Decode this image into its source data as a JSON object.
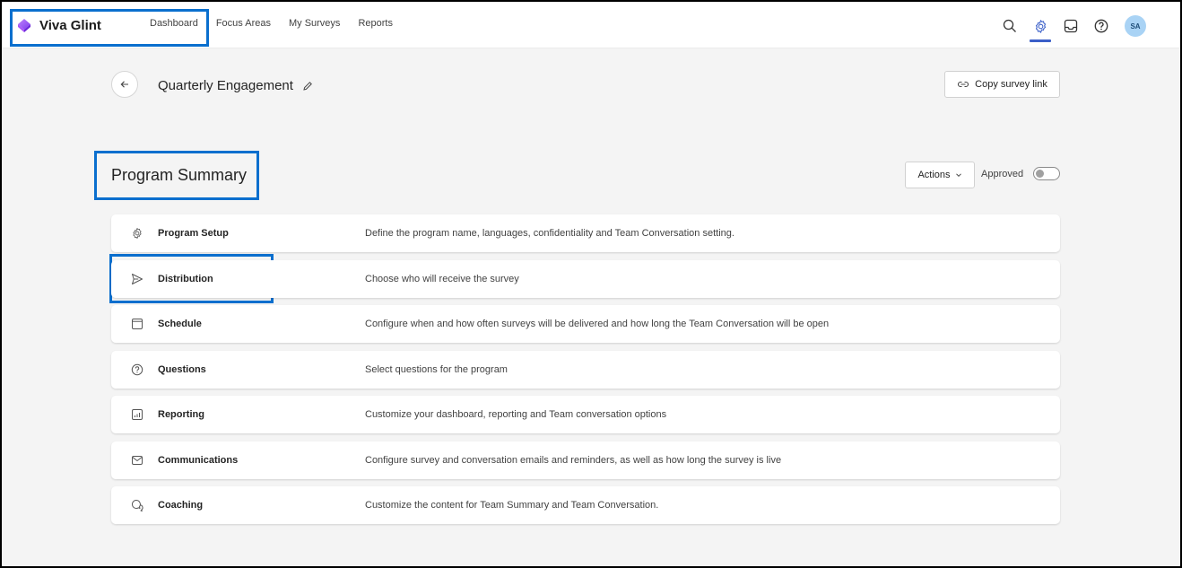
{
  "app": {
    "name": "Viva Glint"
  },
  "nav": {
    "items": [
      {
        "label": "Dashboard"
      },
      {
        "label": "Focus Areas"
      },
      {
        "label": "My Surveys"
      },
      {
        "label": "Reports"
      }
    ]
  },
  "header_icons": {
    "search": "search-icon",
    "settings": "gear-icon",
    "inbox": "inbox-icon",
    "help": "help-icon",
    "avatar_initials": "SA"
  },
  "colors": {
    "accent": "#3b5fc8",
    "highlight_box": "#0a6fce",
    "avatar_bg": "#a9d3f5",
    "page_bg": "#f4f4f4"
  },
  "page": {
    "survey_title": "Quarterly Engagement",
    "copy_link_label": "Copy survey link",
    "section_title": "Program Summary",
    "actions_label": "Actions",
    "approved_label": "Approved",
    "approved_on": false
  },
  "steps": [
    {
      "icon": "gear-icon",
      "label": "Program Setup",
      "description": "Define the program name, languages, confidentiality and Team Conversation setting."
    },
    {
      "icon": "send-icon",
      "label": "Distribution",
      "description": "Choose who will receive the survey"
    },
    {
      "icon": "calendar-icon",
      "label": "Schedule",
      "description": "Configure when and how often surveys will be delivered and how long the Team Conversation will be open"
    },
    {
      "icon": "question-icon",
      "label": "Questions",
      "description": "Select questions for the program"
    },
    {
      "icon": "chart-icon",
      "label": "Reporting",
      "description": "Customize your dashboard, reporting and Team conversation options"
    },
    {
      "icon": "mail-icon",
      "label": "Communications",
      "description": "Configure survey and conversation emails and reminders, as well as how long the survey is live"
    },
    {
      "icon": "chat-icon",
      "label": "Coaching",
      "description": "Customize the content for Team Summary and Team Conversation."
    }
  ]
}
